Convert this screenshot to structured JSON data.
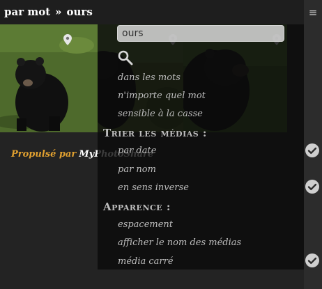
{
  "breadcrumb": {
    "mode": "par mot",
    "separator": "»",
    "query": "ours"
  },
  "menu": {
    "icon": "hamburger-icon",
    "glyph": "≡"
  },
  "search": {
    "value": "ours",
    "icon": "search-icon"
  },
  "search_options": [
    {
      "label": "dans les mots"
    },
    {
      "label": "n'importe quel mot"
    },
    {
      "label": "sensible à la casse"
    }
  ],
  "sort": {
    "title": "Trier les médias :",
    "options": [
      {
        "label": "par date",
        "checked": true
      },
      {
        "label": "par nom",
        "checked": false
      },
      {
        "label": "en sens inverse",
        "checked": true
      }
    ]
  },
  "appearance": {
    "title": "Apparence :",
    "options": [
      {
        "label": "espacement",
        "checked": false
      },
      {
        "label": "afficher le nom des médias",
        "checked": false
      },
      {
        "label": "média carré",
        "checked": true
      }
    ]
  },
  "footer": {
    "powered_by": "Propulsé par",
    "brand": "MyPhotoShare"
  },
  "colors": {
    "accent": "#e0a030",
    "panel": "#0a0a0a",
    "check": "#cfcfcf"
  }
}
